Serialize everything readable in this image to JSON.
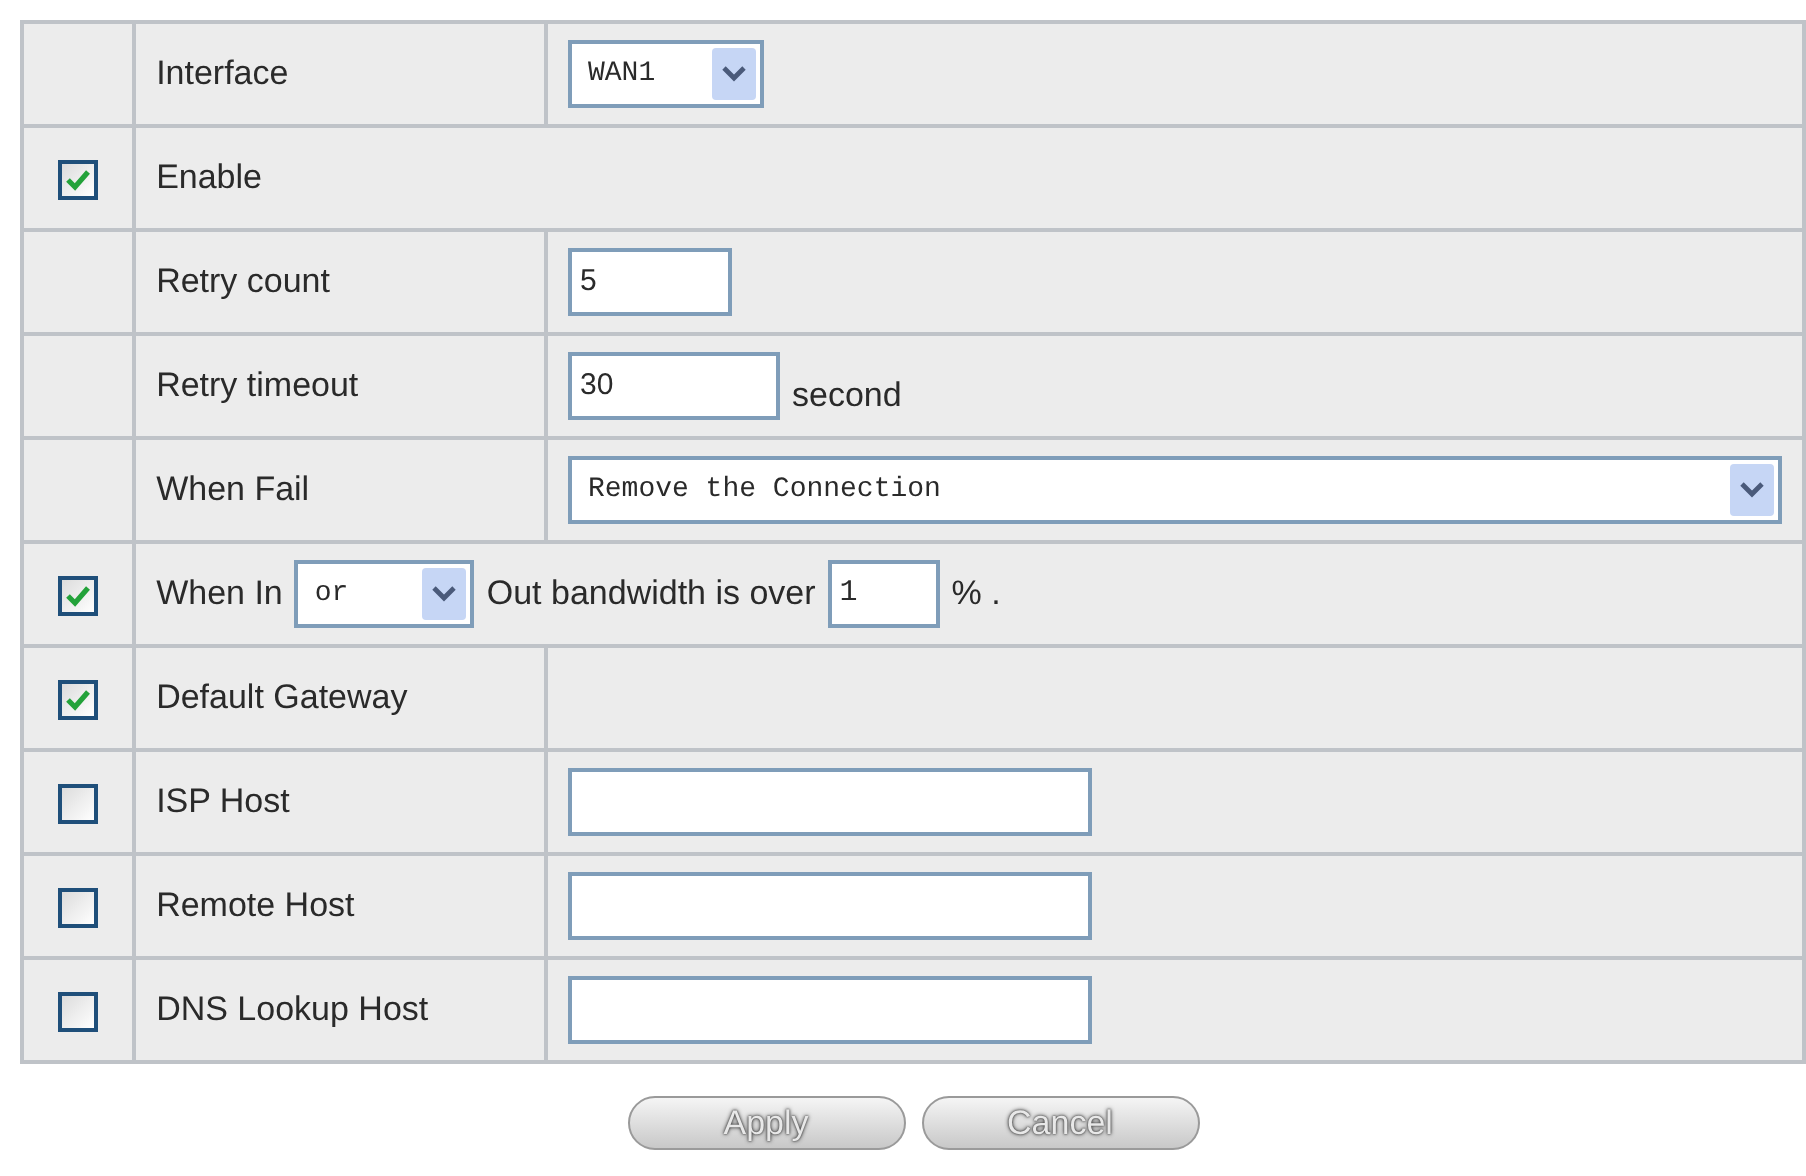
{
  "rows": [
    {
      "kind": "select",
      "label": "Interface",
      "value": "WAN1"
    },
    {
      "kind": "check",
      "checked": true,
      "label": "Enable"
    },
    {
      "kind": "input",
      "label": "Retry count",
      "value": "5"
    },
    {
      "kind": "input",
      "label": "Retry timeout",
      "value": "30",
      "unit": "second"
    },
    {
      "kind": "wide-select",
      "label": "When Fail",
      "value": "Remove the Connection"
    },
    {
      "kind": "bandwidth",
      "checked": true,
      "parts": [
        {
          "kind": "text",
          "text": "When In"
        },
        {
          "kind": "select",
          "value": "or"
        },
        {
          "kind": "text",
          "text": "Out bandwidth is over"
        },
        {
          "kind": "input",
          "value": "1"
        },
        {
          "kind": "text",
          "text": "% ."
        }
      ]
    },
    {
      "kind": "check-empty",
      "checked": true,
      "label": "Default Gateway"
    },
    {
      "kind": "check-input",
      "checked": false,
      "label": "ISP Host"
    },
    {
      "kind": "check-input",
      "checked": false,
      "label": "Remote Host"
    },
    {
      "kind": "check-input",
      "checked": false,
      "label": "DNS Lookup Host"
    }
  ],
  "buttons": [
    "Apply",
    "Cancel"
  ]
}
